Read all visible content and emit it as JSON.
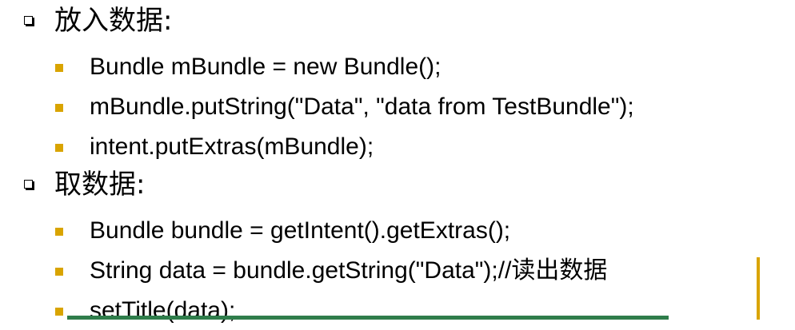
{
  "colors": {
    "bullet_square": "#d9a400",
    "bottom_rule": "#2f7d4b",
    "side_rule": "#d9a400",
    "text": "#000000"
  },
  "sections": [
    {
      "bullet_icon": "hollow-square-bullet",
      "heading": "放入数据:",
      "items": [
        "Bundle mBundle = new Bundle();",
        "mBundle.putString(\"Data\", \"data from TestBundle\");",
        "intent.putExtras(mBundle);"
      ]
    },
    {
      "bullet_icon": "hollow-square-bullet",
      "heading": "取数据:",
      "items": [
        "Bundle bundle = getIntent().getExtras();",
        "String data = bundle.getString(\"Data\");//读出数据",
        "setTitle(data);"
      ]
    }
  ]
}
